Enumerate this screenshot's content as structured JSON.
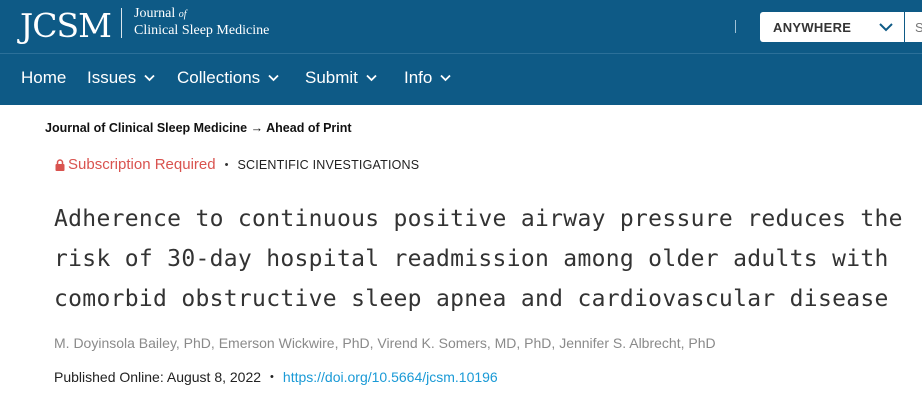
{
  "header": {
    "logo": "JCSM",
    "journal_line1": "Journal",
    "journal_of": "of",
    "journal_line2": "Clinical Sleep Medicine",
    "search_scope": "ANYWHERE",
    "search_placeholder": "S"
  },
  "nav": {
    "items": [
      {
        "label": "Home",
        "dropdown": false
      },
      {
        "label": "Issues",
        "dropdown": true
      },
      {
        "label": "Collections",
        "dropdown": true
      },
      {
        "label": "Submit",
        "dropdown": true
      },
      {
        "label": "Info",
        "dropdown": true
      }
    ]
  },
  "breadcrumb": {
    "journal": "Journal of Clinical Sleep Medicine",
    "arrow": "→",
    "section": "Ahead of Print"
  },
  "article": {
    "access": "Subscription Required",
    "bullet": "•",
    "type": "SCIENTIFIC INVESTIGATIONS",
    "title_line1": "Adherence to continuous positive airway pressure reduces the",
    "title_line2": "risk of 30-day hospital readmission among older adults with",
    "title_line3": "comorbid obstructive sleep apnea and cardiovascular disease",
    "authors": "M. Doyinsola Bailey, PhD, Emerson Wickwire, PhD, Virend K. Somers, MD, PhD, Jennifer S. Albrecht, PhD",
    "published": "Published Online: August 8, 2022",
    "doi": "https://doi.org/10.5664/jcsm.10196"
  },
  "colors": {
    "header_bg": "#0e5a86",
    "subscription": "#d9534f",
    "link": "#1a9ad6"
  },
  "icons": [
    "chevron-down-icon",
    "lock-icon"
  ]
}
